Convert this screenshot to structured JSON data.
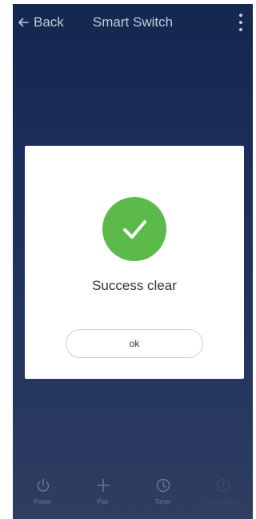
{
  "header": {
    "back_label": "Back",
    "title": "Smart Switch",
    "back_icon": "arrow-left-icon",
    "more_icon": "vertical-dots-icon"
  },
  "dialog": {
    "icon": "checkmark-icon",
    "message": "Success clear",
    "ok_label": "ok",
    "accent_color": "#5cba4a"
  },
  "bottom_nav": {
    "items": [
      {
        "label": "Power",
        "icon": "power-icon"
      },
      {
        "label": "Pair",
        "icon": "plus-icon"
      },
      {
        "label": "Timer",
        "icon": "clock-icon"
      },
      {
        "label": "Countdown",
        "icon": "countdown-icon"
      }
    ]
  }
}
